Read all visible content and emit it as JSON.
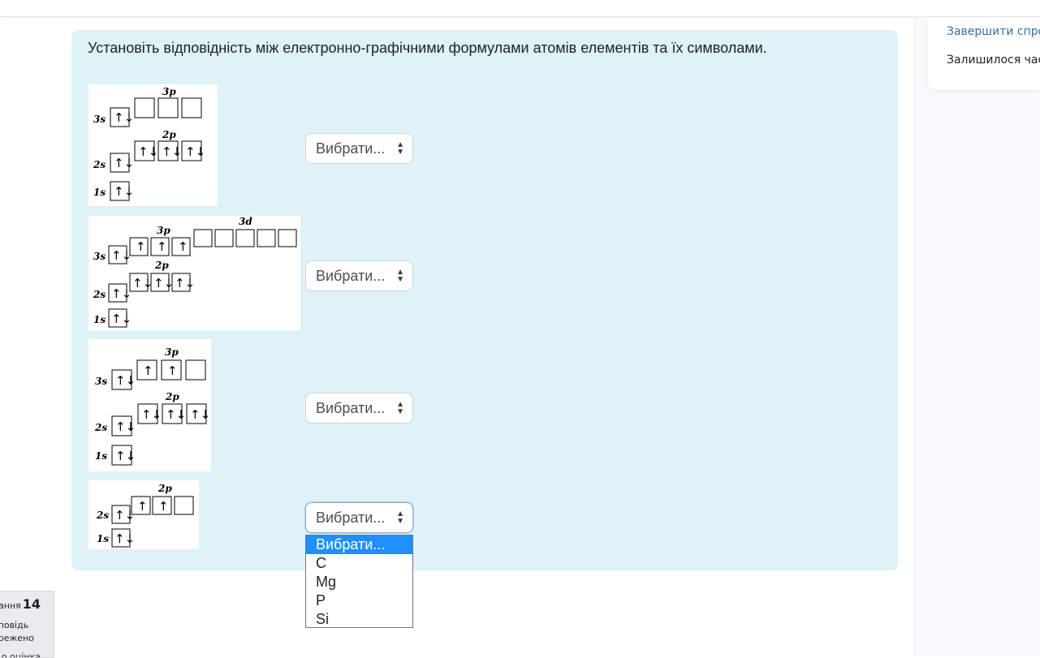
{
  "sidebar": {
    "finish_link": "Завершити спроб",
    "time_left": "Залишилося час"
  },
  "question_info": {
    "number_prefix": "ання",
    "number": "14",
    "state_line1": "повідь",
    "state_line2": "режено",
    "grade_text": "о оцінка"
  },
  "question": {
    "text": "Установіть відповідність між електронно-графічними формулами атомів елементів та їх символами.",
    "diagram_labels": {
      "s3": "3s",
      "s2": "2s",
      "s1": "1s",
      "p3": "3p",
      "p2": "2p",
      "d3": "3d"
    },
    "rows": [
      {
        "selected": "Вибрати..."
      },
      {
        "selected": "Вибрати..."
      },
      {
        "selected": "Вибрати..."
      },
      {
        "selected": "Вибрати..."
      }
    ]
  },
  "dropdown": {
    "options": [
      "Вибрати...",
      "C",
      "Mg",
      "P",
      "Si"
    ],
    "highlighted": "Вибрати..."
  },
  "colors": {
    "formulation_bg": "#def2f8",
    "link": "#3a6ea5",
    "dropdown_highlight": "#1e90ff"
  }
}
